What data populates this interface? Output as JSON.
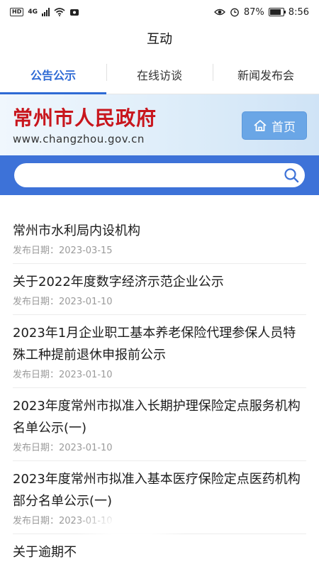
{
  "status_bar": {
    "network": "4G",
    "battery": "87%",
    "battery_level": 0.87,
    "time": "8:56"
  },
  "title": "互动",
  "tabs": [
    {
      "label": "公告公示",
      "active": true
    },
    {
      "label": "在线访谈",
      "active": false
    },
    {
      "label": "新闻发布会",
      "active": false
    }
  ],
  "banner": {
    "name": "常州市人民政府",
    "url": "www.changzhou.gov.cn",
    "home_label": "首页"
  },
  "search": {
    "placeholder": ""
  },
  "date_prefix": "发布日期：",
  "notices": [
    {
      "title": "常州市水利局内设机构",
      "date": "发布日期：2023-03-15"
    },
    {
      "title": "关于2022年度数字经济示范企业公示",
      "date": "发布日期：2023-01-10"
    },
    {
      "title": "2023年1月企业职工基本养老保险代理参保人员特殊工种提前退休申报前公示",
      "date": "发布日期：2023-01-10"
    },
    {
      "title": "2023年度常州市拟准入长期护理保险定点服务机构名单公示(一)",
      "date": "发布日期：2023-01-10"
    },
    {
      "title": "2023年度常州市拟准入基本医疗保险定点医药机构部分名单公示(一)",
      "date": "发布日期：2023-01-10"
    },
    {
      "title": "关于逾期不",
      "date": ""
    }
  ],
  "colors": {
    "accent": "#2e6ad4",
    "brand_red": "#c8161d",
    "search_band": "#3d72d8"
  }
}
